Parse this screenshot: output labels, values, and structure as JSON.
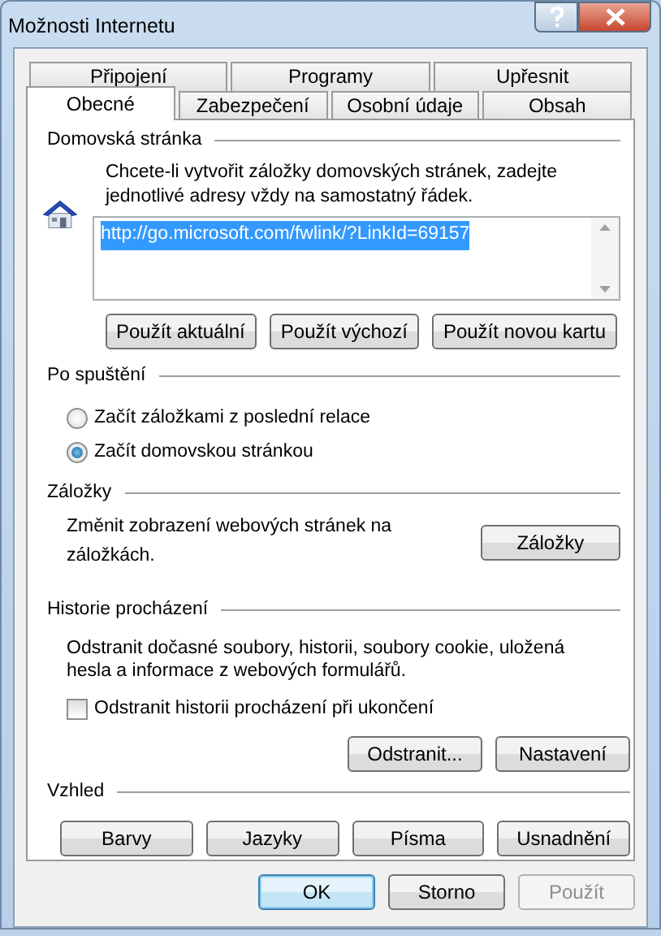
{
  "window": {
    "title": "Možnosti Internetu"
  },
  "tab_rows": [
    [
      {
        "label": "Připojení",
        "selected": false
      },
      {
        "label": "Programy",
        "selected": false
      },
      {
        "label": "Upřesnit",
        "selected": false
      }
    ],
    [
      {
        "label": "Obecné",
        "selected": true
      },
      {
        "label": "Zabezpečení",
        "selected": false
      },
      {
        "label": "Osobní údaje",
        "selected": false
      },
      {
        "label": "Obsah",
        "selected": false
      }
    ]
  ],
  "home_page": {
    "title": "Domovská stránka",
    "description": "Chcete-li vytvořit záložky domovských stránek, zadejte jednotlivé adresy vždy na samostatný řádek.",
    "url": "http://go.microsoft.com/fwlink/?LinkId=69157",
    "buttons": [
      "Použít aktuální",
      "Použít výchozí",
      "Použít novou kartu"
    ]
  },
  "startup": {
    "title": "Po spuštění",
    "options": [
      {
        "label": "Začít záložkami z poslední relace",
        "selected": false
      },
      {
        "label": "Začít domovskou stránkou",
        "selected": true
      }
    ]
  },
  "tabs_section": {
    "title": "Záložky",
    "description": "Změnit zobrazení webových stránek na záložkách.",
    "button": "Záložky"
  },
  "history": {
    "title": "Historie procházení",
    "description": "Odstranit dočasné soubory, historii, soubory cookie, uložená hesla a informace z webových formulářů.",
    "checkbox": {
      "label": "Odstranit historii procházení při ukončení",
      "checked": false
    },
    "buttons": [
      "Odstranit...",
      "Nastavení"
    ]
  },
  "appearance": {
    "title": "Vzhled",
    "buttons": [
      "Barvy",
      "Jazyky",
      "Písma",
      "Usnadnění"
    ]
  },
  "footer_buttons": [
    {
      "label": "OK",
      "default": true,
      "disabled": false
    },
    {
      "label": "Storno",
      "default": false,
      "disabled": false
    },
    {
      "label": "Použít",
      "default": false,
      "disabled": true
    }
  ]
}
